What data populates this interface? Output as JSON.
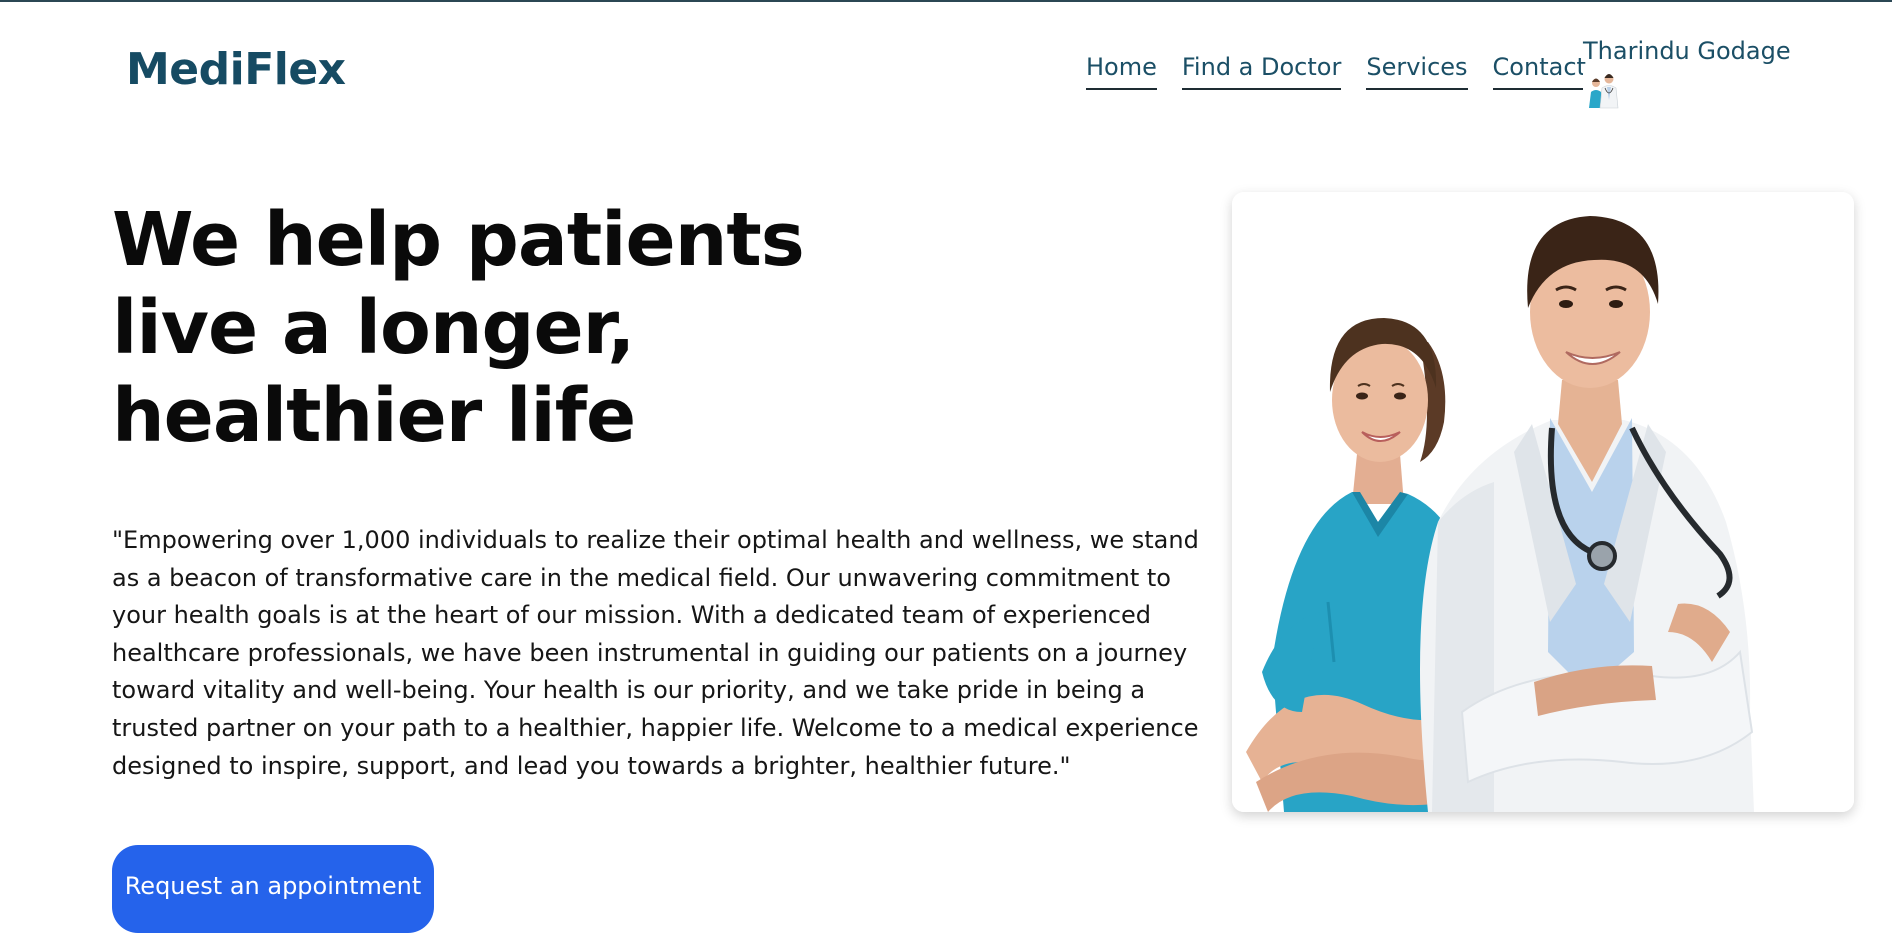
{
  "header": {
    "brand": "MediFlex",
    "nav": [
      {
        "label": "Home"
      },
      {
        "label": "Find a Doctor"
      },
      {
        "label": "Services"
      },
      {
        "label": "Contact"
      }
    ],
    "user": {
      "name": "Tharindu Godage",
      "avatar_icon": "doctors-avatar-icon"
    }
  },
  "hero": {
    "title_lines": [
      "We help patients",
      "live a longer,",
      "healthier life"
    ],
    "description_lines": [
      "\"Empowering over 1,000 individuals to realize their optimal health and wellness, we stand",
      "as a beacon of transformative care in the medical field. Our unwavering commitment to",
      "your health goals is at the heart of our mission. With a dedicated team of experienced",
      "healthcare professionals, we have been instrumental in guiding our patients on a journey",
      "toward vitality and well-being. Your health is our priority, and we take pride in being a",
      "trusted partner on your path to a healthier, happier life. Welcome to a medical experience",
      "designed to inspire, support, and lead you towards a brighter, healthier future.\""
    ],
    "cta_label": "Request an appointment",
    "image_icon": "doctor-and-nurse-photo"
  },
  "colors": {
    "brand": "#164b63",
    "nav_text": "#1b4f66",
    "cta_bg": "#2563eb",
    "scrubs": "#2aa7c9",
    "coat": "#f4f6f8"
  }
}
